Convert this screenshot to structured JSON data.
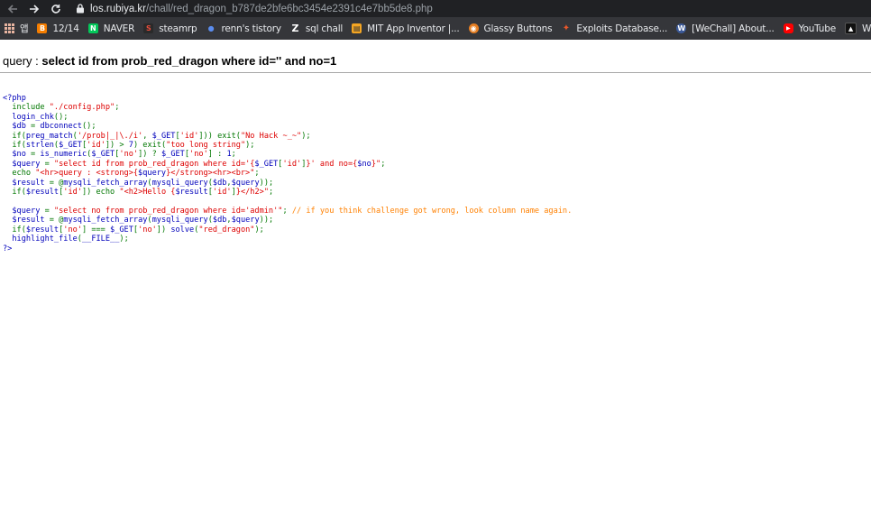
{
  "browser": {
    "url_host": "los.rubiya.kr",
    "url_path": "/chall/red_dragon_b787de2bfe6bc3454e2391c4e7bb5de8.php",
    "bookmarks": [
      {
        "label": "앱",
        "icon": "apps-grid-icon",
        "color": "#e8b4a0"
      },
      {
        "label": "12/14",
        "icon": "blogger-icon",
        "color": "#f57d00"
      },
      {
        "label": "NAVER",
        "icon": "naver-icon",
        "color": "#03c75a"
      },
      {
        "label": "steamrp",
        "icon": "steamrp-icon",
        "color": "#c0392b"
      },
      {
        "label": "renn's tistory",
        "icon": "tistory-icon",
        "color": "#5b8def"
      },
      {
        "label": "sql chall",
        "icon": "z-icon",
        "color": "#ffffff"
      },
      {
        "label": "MIT App Inventor |...",
        "icon": "app-inventor-icon",
        "color": "#f5a623"
      },
      {
        "label": "Glassy Buttons",
        "icon": "glassy-icon",
        "color": "#e67e22"
      },
      {
        "label": "Exploits Database...",
        "icon": "exploitdb-icon",
        "color": "#e8572a"
      },
      {
        "label": "[WeChall] About...",
        "icon": "wechall-icon",
        "color": "#3b5998"
      },
      {
        "label": "YouTube",
        "icon": "youtube-icon",
        "color": "#ff0000"
      },
      {
        "label": "Whats My IP Addr...",
        "icon": "ip-icon",
        "color": "#444444"
      }
    ]
  },
  "page": {
    "query_label": "query : ",
    "query_text": "select id from prob_red_dragon where id='' and no=1"
  },
  "code": {
    "l01": "<?php",
    "l02_a": "  include ",
    "l02_b": "\"./config.php\"",
    "l02_c": ";",
    "l03_a": "  login_chk",
    "l03_b": "();",
    "l04_a": "  $db ",
    "l04_b": "= ",
    "l04_c": "dbconnect",
    "l04_d": "();",
    "l05_a": "  if(",
    "l05_b": "preg_match",
    "l05_c": "(",
    "l05_d": "'/prob|_|\\./i'",
    "l05_e": ", ",
    "l05_f": "$_GET",
    "l05_g": "[",
    "l05_h": "'id'",
    "l05_i": "])) exit(",
    "l05_j": "\"No Hack ~_~\"",
    "l05_k": ");",
    "l06_a": "  if(",
    "l06_b": "strlen",
    "l06_c": "(",
    "l06_d": "$_GET",
    "l06_e": "[",
    "l06_f": "'id'",
    "l06_g": "]) > ",
    "l06_h": "7",
    "l06_i": ") exit(",
    "l06_j": "\"too long string\"",
    "l06_k": ");",
    "l07_a": "  $no ",
    "l07_b": "= ",
    "l07_c": "is_numeric",
    "l07_d": "(",
    "l07_e": "$_GET",
    "l07_f": "[",
    "l07_g": "'no'",
    "l07_h": "]) ? ",
    "l07_i": "$_GET",
    "l07_j": "[",
    "l07_k": "'no'",
    "l07_l": "] : ",
    "l07_m": "1",
    "l07_n": ";",
    "l08_a": "  $query ",
    "l08_b": "= ",
    "l08_c": "\"select id from prob_red_dragon where id='{",
    "l08_d": "$_GET",
    "l08_e": "[",
    "l08_f": "'id'",
    "l08_g": "]",
    "l08_h": "}' and no={",
    "l08_i": "$no",
    "l08_j": "}\"",
    "l08_k": ";",
    "l09_a": "  echo ",
    "l09_b": "\"<hr>query : <strong>{",
    "l09_c": "$query",
    "l09_d": "}</strong><hr><br>\"",
    "l09_e": ";",
    "l10_a": "  $result ",
    "l10_b": "= @",
    "l10_c": "mysqli_fetch_array",
    "l10_d": "(",
    "l10_e": "mysqli_query",
    "l10_f": "(",
    "l10_g": "$db",
    "l10_h": ",",
    "l10_i": "$query",
    "l10_j": "));",
    "l11_a": "  if(",
    "l11_b": "$result",
    "l11_c": "[",
    "l11_d": "'id'",
    "l11_e": "]) echo ",
    "l11_f": "\"<h2>Hello {",
    "l11_g": "$result",
    "l11_h": "[",
    "l11_i": "'id'",
    "l11_j": "]",
    "l11_k": "}</h2>\"",
    "l11_l": ";",
    "l13_a": "  $query ",
    "l13_b": "= ",
    "l13_c": "\"select no from prob_red_dragon where id='admin'\"",
    "l13_d": "; ",
    "l13_e": "// if you think challenge got wrong, look column name again.",
    "l14_a": "  $result ",
    "l14_b": "= @",
    "l14_c": "mysqli_fetch_array",
    "l14_d": "(",
    "l14_e": "mysqli_query",
    "l14_f": "(",
    "l14_g": "$db",
    "l14_h": ",",
    "l14_i": "$query",
    "l14_j": "));",
    "l15_a": "  if(",
    "l15_b": "$result",
    "l15_c": "[",
    "l15_d": "'no'",
    "l15_e": "] === ",
    "l15_f": "$_GET",
    "l15_g": "[",
    "l15_h": "'no'",
    "l15_i": "]) ",
    "l15_j": "solve",
    "l15_k": "(",
    "l15_l": "\"red_dragon\"",
    "l15_m": ");",
    "l16_a": "  highlight_file",
    "l16_b": "(",
    "l16_c": "__FILE__",
    "l16_d": ");",
    "l17": "?>"
  }
}
